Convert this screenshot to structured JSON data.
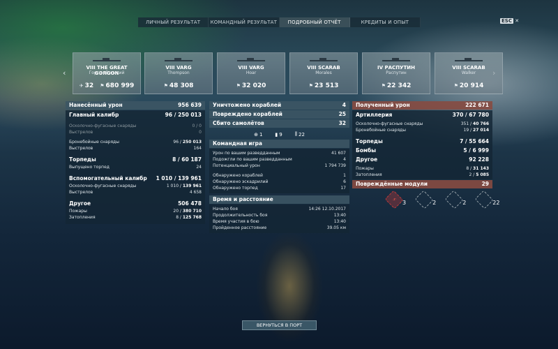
{
  "tabs": [
    {
      "label": "ЛИЧНЫЙ РЕЗУЛЬТАТ",
      "active": false
    },
    {
      "label": "КОМАНДНЫЙ РЕЗУЛЬТАТ",
      "active": false
    },
    {
      "label": "ПОДРОБНЫЙ ОТЧЁТ",
      "active": true
    },
    {
      "label": "КРЕДИТЫ И ОПЫТ",
      "active": false
    }
  ],
  "esc": {
    "key": "ESC",
    "glyph": "✕"
  },
  "ships": [
    {
      "name": "VIII THE GREAT GORGON",
      "player": "Горгон Великий",
      "kills": "32",
      "damage": "680 999"
    },
    {
      "name": "VIII VARG",
      "player": "Thompson",
      "kills": "",
      "damage": "48 308"
    },
    {
      "name": "VIII VARG",
      "player": "Hoar",
      "kills": "",
      "damage": "32 020"
    },
    {
      "name": "VIII SCARAB",
      "player": "Morales",
      "kills": "",
      "damage": "23 513"
    },
    {
      "name": "IV РАСПУТИН",
      "player": "Распутин",
      "kills": "",
      "damage": "22 342"
    },
    {
      "name": "VIII SCARAB",
      "player": "Walker",
      "kills": "",
      "damage": "20 914"
    }
  ],
  "left": {
    "damage_dealt": {
      "label": "Нанесённый урон",
      "value": "956 639"
    },
    "main_battery": {
      "label": "Главный калибр",
      "value_a": "96",
      "value_b": "250 013"
    },
    "mb_he": {
      "label": "Осколочно-фугасные снаряды",
      "value": "0 / 0"
    },
    "mb_he_shots": {
      "label": "Выстрелов",
      "value": "0"
    },
    "mb_ap": {
      "label": "Бронебойные снаряды",
      "value_a": "96",
      "value_b": "250 013"
    },
    "mb_ap_shots": {
      "label": "Выстрелов",
      "value": "164"
    },
    "torpedoes": {
      "label": "Торпеды",
      "value_a": "8",
      "value_b": "60 187"
    },
    "torp_launched": {
      "label": "Выпущено торпед",
      "value": "24"
    },
    "secondary": {
      "label": "Вспомогательный калибр",
      "value_a": "1 010",
      "value_b": "139 961"
    },
    "sec_he": {
      "label": "Осколочно-фугасные снаряды",
      "value_a": "1 010",
      "value_b": "139 961"
    },
    "sec_shots": {
      "label": "Выстрелов",
      "value": "4 658"
    },
    "other": {
      "label": "Другое",
      "value": "506 478"
    },
    "fires": {
      "label": "Пожары",
      "value_a": "20",
      "value_b": "380 710"
    },
    "floods": {
      "label": "Затопления",
      "value_a": "8",
      "value_b": "125 768"
    }
  },
  "middle": {
    "destroyed": {
      "label": "Уничтожено кораблей",
      "value": "4"
    },
    "damaged": {
      "label": "Повреждено кораблей",
      "value": "25"
    },
    "planes": {
      "label": "Сбито самолётов",
      "value": "32"
    },
    "icons": [
      {
        "icon": "crosshair-icon",
        "glyph": "⊕",
        "value": "1"
      },
      {
        "icon": "shell-icon",
        "glyph": "▮",
        "value": "9"
      },
      {
        "icon": "torpedo-icon",
        "glyph": "⫼",
        "value": "22"
      }
    ],
    "team": {
      "title": "Командная игра",
      "rows": [
        {
          "label": "Урон по вашим разведданным",
          "value": "41 607"
        },
        {
          "label": "Подожгли по вашим разведданным",
          "value": "4"
        },
        {
          "label": "Потенциальный урон",
          "value": "1 794 739"
        },
        {
          "label": "Обнаружено кораблей",
          "value": "1"
        },
        {
          "label": "Обнаружено эскадрилий",
          "value": "6"
        },
        {
          "label": "Обнаружено торпед",
          "value": "17"
        }
      ]
    },
    "time": {
      "title": "Время и расстояние",
      "rows": [
        {
          "label": "Начало боя",
          "value": "14:26  12.10.2017"
        },
        {
          "label": "Продолжительность боя",
          "value": "13:40"
        },
        {
          "label": "Время участия в бою",
          "value": "13:40"
        },
        {
          "label": "Пройденное расстояние",
          "value": "39.05 км"
        }
      ]
    }
  },
  "right": {
    "damage_received": {
      "label": "Полученный урон",
      "value": "222 671"
    },
    "artillery": {
      "label": "Артиллерия",
      "value_a": "370",
      "value_b": "67 780"
    },
    "he": {
      "label": "Осколочно-фугасные снаряды",
      "value_a": "351",
      "value_b": "40 766"
    },
    "ap": {
      "label": "Бронебойные снаряды",
      "value_a": "19",
      "value_b": "27 014"
    },
    "torpedoes": {
      "label": "Торпеды",
      "value_a": "7",
      "value_b": "55 664"
    },
    "bombs": {
      "label": "Бомбы",
      "value_a": "5",
      "value_b": "6 999"
    },
    "other": {
      "label": "Другое",
      "value": "92 228"
    },
    "fires": {
      "label": "Пожары",
      "value_a": "8",
      "value_b": "31 143"
    },
    "floods": {
      "label": "Затопления",
      "value_a": "2",
      "value_b": "5 085"
    },
    "modules": {
      "label": "Повреждённые модули",
      "value": "29"
    },
    "module_icons": [
      {
        "icon": "engine-damage-icon",
        "value": "3",
        "red": true
      },
      {
        "icon": "steering-damage-icon",
        "value": "2",
        "red": false
      },
      {
        "icon": "turret-damage-icon",
        "value": "2",
        "red": false
      },
      {
        "icon": "aa-damage-icon",
        "value": "22",
        "red": false
      }
    ]
  },
  "back_button": {
    "label": "ВЕРНУТЬСЯ В ПОРТ"
  }
}
